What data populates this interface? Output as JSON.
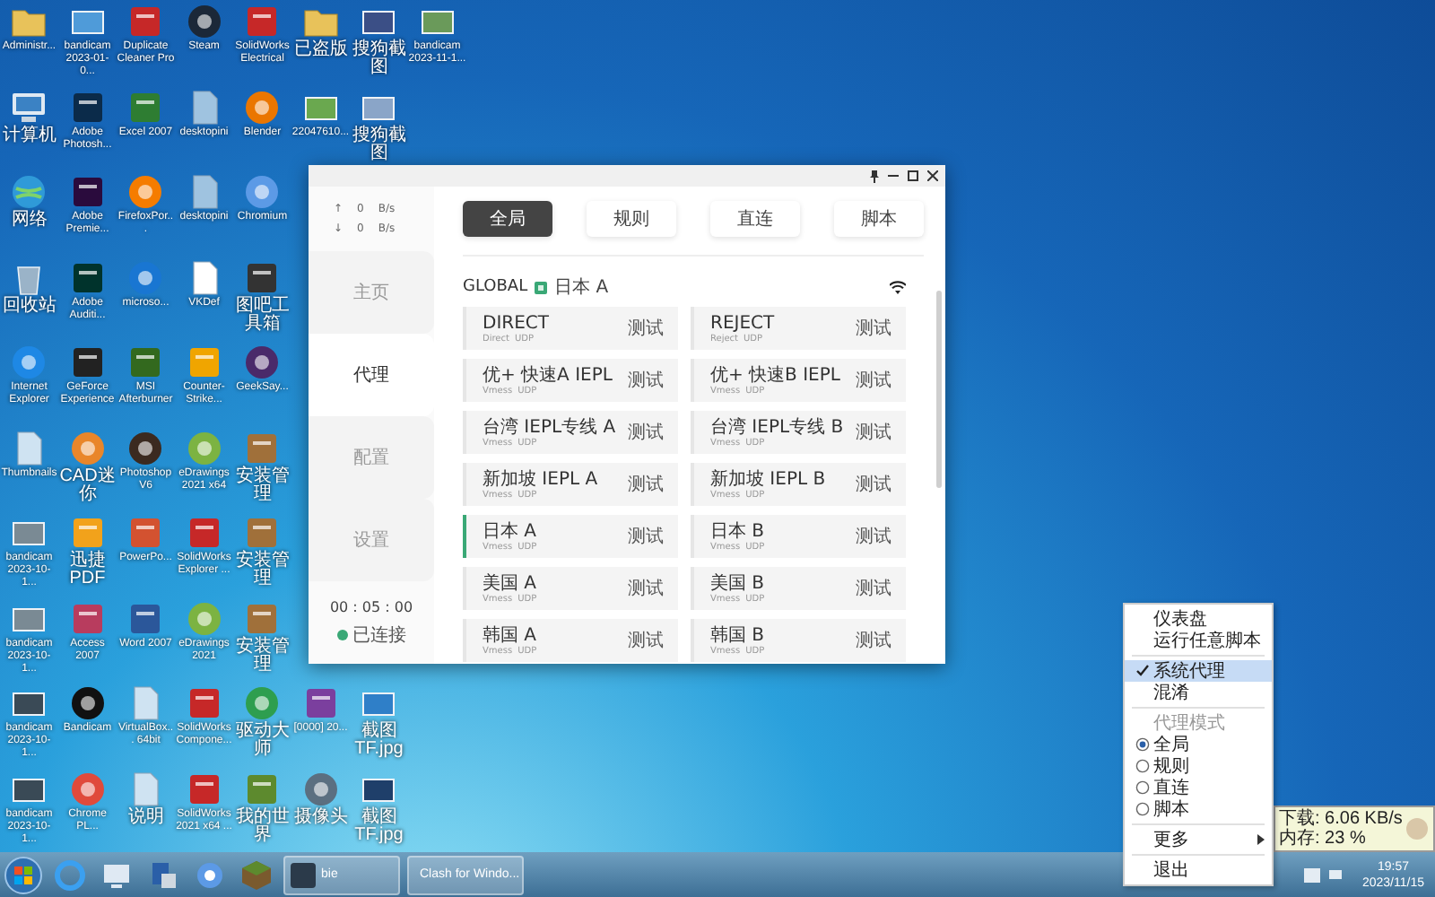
{
  "desktop": {
    "columns": [
      {
        "top": [
          {
            "label": "Administr...",
            "kind": "folder",
            "color": "#e8c25a"
          },
          {
            "label": "计算机",
            "kind": "computer",
            "color": "#3b82c4"
          },
          {
            "label": "网络",
            "kind": "network",
            "color": "#2f9ad8"
          },
          {
            "label": "回收站",
            "kind": "trash",
            "color": "#9ab3c8"
          },
          {
            "label": "Internet Explorer",
            "kind": "round",
            "color": "#1e88e5"
          },
          {
            "label": "Thumbnails",
            "kind": "document",
            "color": "#cfe3f2"
          },
          {
            "label": "bandicam 2023-10-1...",
            "kind": "image",
            "color": "#7a8a94"
          },
          {
            "label": "bandicam 2023-10-1...",
            "kind": "image",
            "color": "#7a8a94"
          },
          {
            "label": "bandicam 2023-10-1...",
            "kind": "image",
            "color": "#3a4a56"
          },
          {
            "label": "bandicam 2023-10-1...",
            "kind": "image",
            "color": "#3a4a56"
          }
        ]
      },
      {
        "top": [
          {
            "label": "bandicam 2023-01-0...",
            "kind": "image",
            "color": "#4f9bd9"
          },
          {
            "label": "Adobe Photosh...",
            "kind": "app",
            "color": "#0b2b4a"
          },
          {
            "label": "Adobe Premie...",
            "kind": "app",
            "color": "#2a0b3d"
          },
          {
            "label": "Adobe Auditi...",
            "kind": "app",
            "color": "#00332c"
          },
          {
            "label": "GeForce Experience",
            "kind": "app",
            "color": "#222222"
          },
          {
            "label": "CAD迷你",
            "kind": "round",
            "color": "#e9862a"
          },
          {
            "label": "迅捷PDF",
            "kind": "app",
            "color": "#f2a21b"
          },
          {
            "label": "Access 2007",
            "kind": "app",
            "color": "#b83c5e"
          },
          {
            "label": "Bandicam",
            "kind": "round",
            "color": "#111111"
          },
          {
            "label": "Chrome PL...",
            "kind": "round",
            "color": "#e04a3b"
          }
        ]
      },
      {
        "top": [
          {
            "label": "Duplicate Cleaner Pro",
            "kind": "app",
            "color": "#c62828"
          },
          {
            "label": "Excel 2007",
            "kind": "app",
            "color": "#2e7d32"
          },
          {
            "label": "FirefoxPor...",
            "kind": "round",
            "color": "#f57c00"
          },
          {
            "label": "microso...",
            "kind": "round",
            "color": "#1976d2"
          },
          {
            "label": "MSI Afterburner",
            "kind": "app",
            "color": "#33691e"
          },
          {
            "label": "Photoshop V6",
            "kind": "round",
            "color": "#3b2a20"
          },
          {
            "label": "PowerPo...",
            "kind": "app",
            "color": "#d35230"
          },
          {
            "label": "Word 2007",
            "kind": "app",
            "color": "#2b579a"
          },
          {
            "label": "VirtualBox... 64bit",
            "kind": "document",
            "color": "#cfe3f2"
          },
          {
            "label": "说明",
            "kind": "document",
            "color": "#cfe3f2"
          }
        ]
      },
      {
        "top": [
          {
            "label": "Steam",
            "kind": "round",
            "color": "#1b2838"
          },
          {
            "label": "desktopini",
            "kind": "document",
            "color": "#9fc3e0"
          },
          {
            "label": "desktopini",
            "kind": "document",
            "color": "#9fc3e0"
          },
          {
            "label": "VKDef",
            "kind": "document",
            "color": "#ffffff"
          },
          {
            "label": "Counter-Strike...",
            "kind": "app",
            "color": "#f0a500"
          },
          {
            "label": "eDrawings 2021 x64",
            "kind": "round",
            "color": "#7cb342"
          },
          {
            "label": "SolidWorks Explorer ...",
            "kind": "app",
            "color": "#c62828"
          },
          {
            "label": "eDrawings 2021",
            "kind": "round",
            "color": "#7cb342"
          },
          {
            "label": "SolidWorks Compone...",
            "kind": "app",
            "color": "#c62828"
          },
          {
            "label": "SolidWorks 2021 x64 ...",
            "kind": "app",
            "color": "#c62828"
          }
        ]
      },
      {
        "top": [
          {
            "label": "SolidWorks Electrical",
            "kind": "app",
            "color": "#c62828"
          },
          {
            "label": "Blender",
            "kind": "round",
            "color": "#ea7600"
          },
          {
            "label": "Chromium",
            "kind": "round",
            "color": "#5c9ae6"
          },
          {
            "label": "图吧工具箱",
            "kind": "app",
            "color": "#333333"
          },
          {
            "label": "GeekSay...",
            "kind": "round",
            "color": "#4a2a6a"
          },
          {
            "label": "安装管理",
            "kind": "app",
            "color": "#a0703a"
          },
          {
            "label": "安装管理",
            "kind": "app",
            "color": "#a0703a"
          },
          {
            "label": "安装管理",
            "kind": "app",
            "color": "#a0703a"
          },
          {
            "label": "驱动大师",
            "kind": "round",
            "color": "#2e9e4f"
          },
          {
            "label": "我的世界",
            "kind": "app",
            "color": "#5d8a2e"
          }
        ]
      },
      {
        "top": [
          {
            "label": "已盗版",
            "kind": "folder",
            "color": "#e8c25a"
          },
          {
            "label": "22047610...",
            "kind": "image",
            "color": "#6aa84f"
          }
        ],
        "bottom": [
          {
            "label": "[0000] 20...",
            "kind": "app",
            "color": "#7b3f9e"
          },
          {
            "label": "摄像头",
            "kind": "round",
            "color": "#5b6f80"
          }
        ]
      },
      {
        "top": [
          {
            "label": "搜狗截图",
            "kind": "image",
            "color": "#3b4f86"
          },
          {
            "label": "搜狗截图",
            "kind": "image",
            "color": "#8aa5c8"
          }
        ],
        "bottom": [
          {
            "label": "截图 TF.jpg",
            "kind": "image",
            "color": "#2f7fc8"
          },
          {
            "label": "截图 TF.jpg",
            "kind": "image",
            "color": "#1f3f6a"
          }
        ]
      },
      {
        "top": [
          {
            "label": "bandicam 2023-11-1...",
            "kind": "image",
            "color": "#6a9a5a"
          }
        ]
      }
    ]
  },
  "app_window": {
    "traffic": [
      {
        "arrow": "↑",
        "value": "0",
        "unit": "B/s"
      },
      {
        "arrow": "↓",
        "value": "0",
        "unit": "B/s"
      }
    ],
    "nav": [
      {
        "label": "主页",
        "selected": false
      },
      {
        "label": "代理",
        "selected": true
      },
      {
        "label": "配置",
        "selected": false
      },
      {
        "label": "设置",
        "selected": false
      }
    ],
    "timer": "00 : 05 : 00",
    "status": {
      "label": "已连接",
      "connected": true
    },
    "mode_tabs": [
      {
        "label": "全局",
        "selected": true
      },
      {
        "label": "规则",
        "selected": false
      },
      {
        "label": "直连",
        "selected": false
      },
      {
        "label": "脚本",
        "selected": false
      }
    ],
    "group": {
      "name": "GLOBAL",
      "current": "日本 A"
    },
    "proxies": [
      {
        "name": "DIRECT",
        "type": "Direct",
        "udp": "UDP",
        "action": "测试",
        "selected": false
      },
      {
        "name": "REJECT",
        "type": "Reject",
        "udp": "UDP",
        "action": "测试",
        "selected": false
      },
      {
        "name": "优+ 快速A IEPL",
        "type": "Vmess",
        "udp": "UDP",
        "action": "测试",
        "selected": false
      },
      {
        "name": "优+ 快速B IEPL",
        "type": "Vmess",
        "udp": "UDP",
        "action": "测试",
        "selected": false
      },
      {
        "name": "台湾 IEPL专线 A",
        "type": "Vmess",
        "udp": "UDP",
        "action": "测试",
        "selected": false
      },
      {
        "name": "台湾 IEPL专线 B",
        "type": "Vmess",
        "udp": "UDP",
        "action": "测试",
        "selected": false
      },
      {
        "name": "新加坡 IEPL A",
        "type": "Vmess",
        "udp": "UDP",
        "action": "测试",
        "selected": false
      },
      {
        "name": "新加坡 IEPL B",
        "type": "Vmess",
        "udp": "UDP",
        "action": "测试",
        "selected": false
      },
      {
        "name": "日本 A",
        "type": "Vmess",
        "udp": "UDP",
        "action": "测试",
        "selected": true
      },
      {
        "name": "日本 B",
        "type": "Vmess",
        "udp": "UDP",
        "action": "测试",
        "selected": false
      },
      {
        "name": "美国 A",
        "type": "Vmess",
        "udp": "UDP",
        "action": "测试",
        "selected": false
      },
      {
        "name": "美国 B",
        "type": "Vmess",
        "udp": "UDP",
        "action": "测试",
        "selected": false
      },
      {
        "name": "韩国 A",
        "type": "Vmess",
        "udp": "UDP",
        "action": "测试",
        "selected": false
      },
      {
        "name": "韩国 B",
        "type": "Vmess",
        "udp": "UDP",
        "action": "测试",
        "selected": false
      }
    ]
  },
  "tray_menu": [
    {
      "kind": "action",
      "label": "仪表盘",
      "highlighted": false
    },
    {
      "kind": "action",
      "label": "运行任意脚本",
      "highlighted": false
    },
    {
      "kind": "separator",
      "highlighted": false
    },
    {
      "kind": "check",
      "label": "系统代理",
      "checked": true,
      "highlighted": true
    },
    {
      "kind": "action",
      "label": "混淆",
      "highlighted": false
    },
    {
      "kind": "separator",
      "highlighted": false
    },
    {
      "kind": "header",
      "label": "代理模式",
      "highlighted": false
    },
    {
      "kind": "radio",
      "label": "全局",
      "selected": true,
      "highlighted": false
    },
    {
      "kind": "radio",
      "label": "规则",
      "selected": false,
      "highlighted": false
    },
    {
      "kind": "radio",
      "label": "直连",
      "selected": false,
      "highlighted": false
    },
    {
      "kind": "radio",
      "label": "脚本",
      "selected": false,
      "highlighted": false
    },
    {
      "kind": "separator",
      "highlighted": false
    },
    {
      "kind": "submenu",
      "label": "更多",
      "highlighted": false
    },
    {
      "kind": "separator",
      "highlighted": false
    },
    {
      "kind": "action",
      "label": "退出",
      "highlighted": false
    }
  ],
  "tray_tooltip": {
    "lines": [
      "下载: 6.06 KB/s",
      "内存: 23 %"
    ]
  },
  "taskbar": {
    "tasks": [
      {
        "label": "bie"
      },
      {
        "label": "Clash for Windo..."
      }
    ],
    "clock": {
      "time": "19:57",
      "date": "2023/11/15"
    }
  }
}
